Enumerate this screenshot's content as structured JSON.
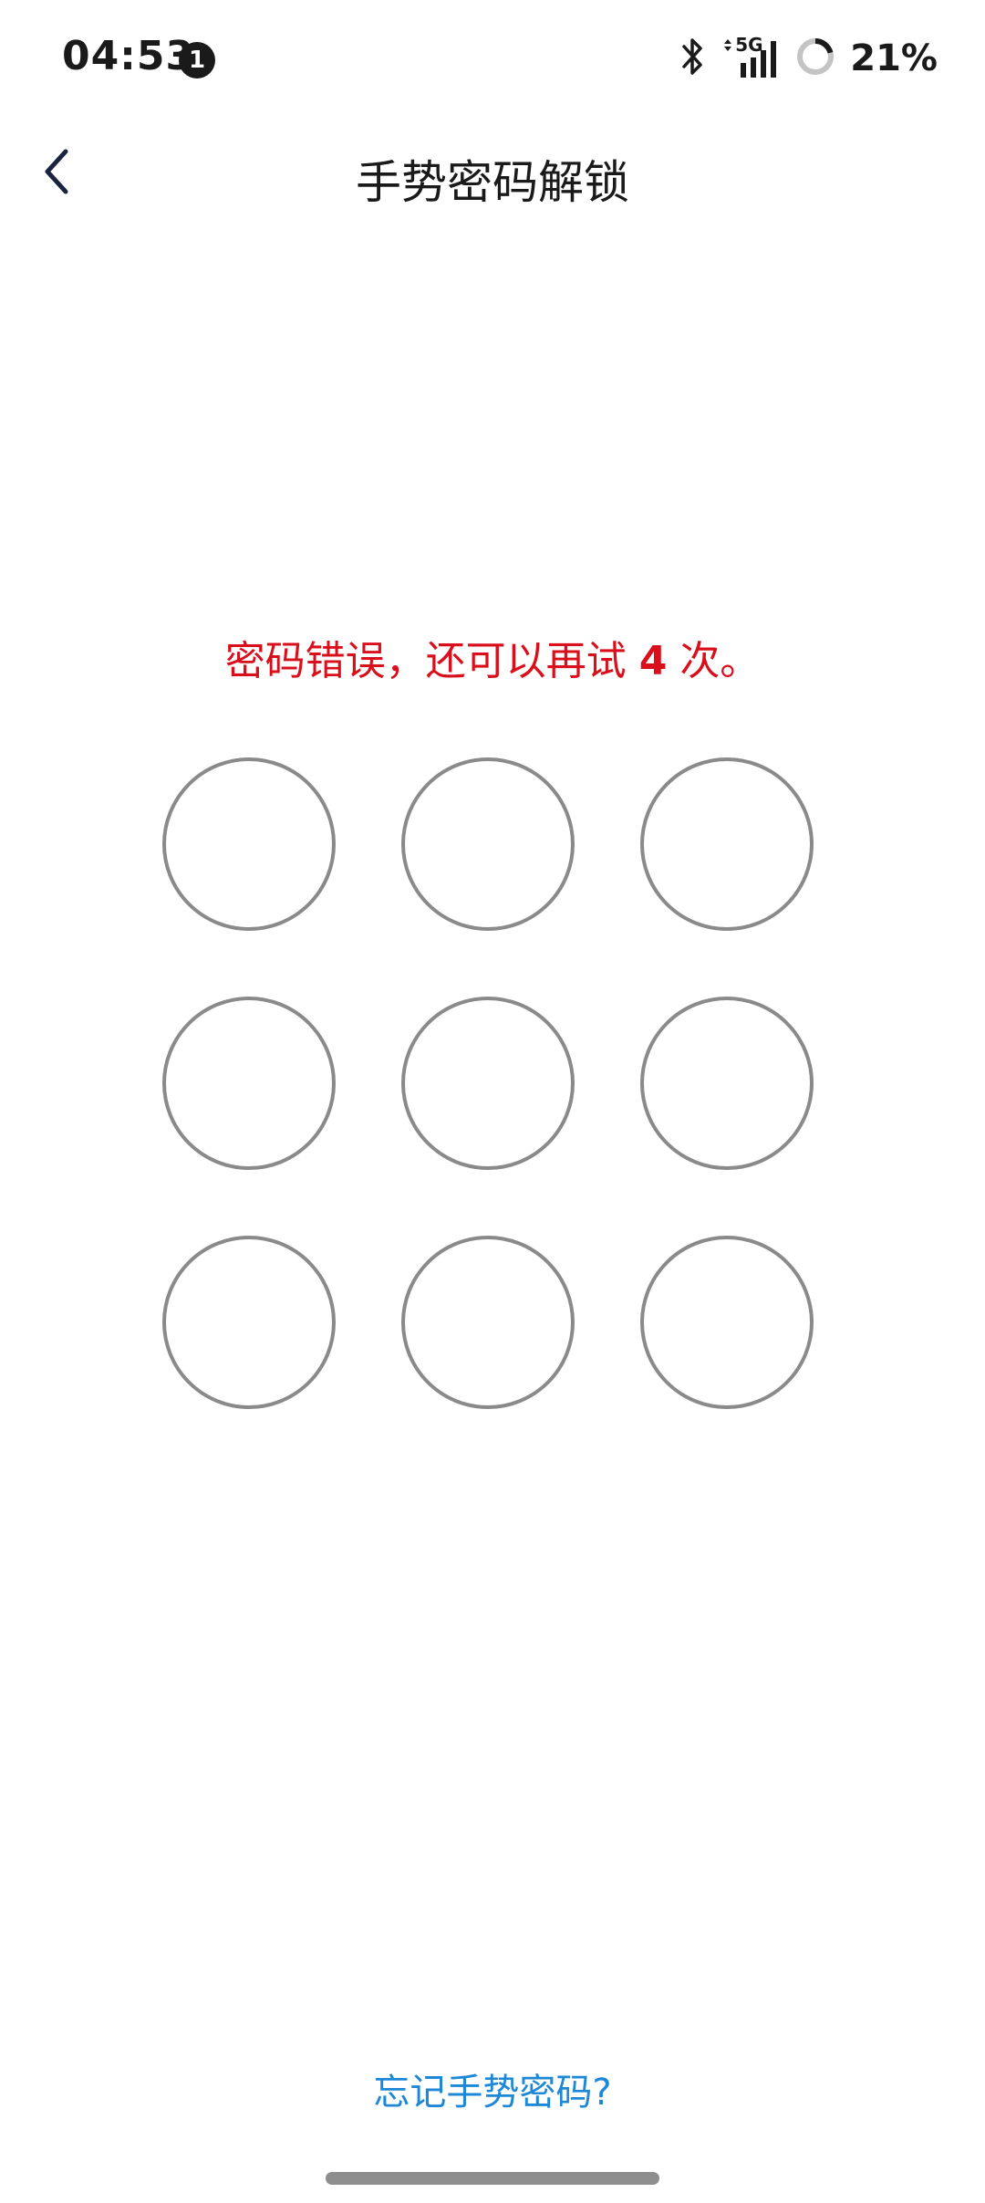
{
  "status_bar": {
    "time": "04:53",
    "notification_count": "1",
    "network": "5G",
    "battery_percent": "21%",
    "battery_level": 0.21
  },
  "header": {
    "title": "手势密码解锁"
  },
  "message": {
    "prefix": "密码错误，还可以再试",
    "attempts": "4",
    "suffix": "次。",
    "color": "#d9101c"
  },
  "pattern": {
    "rows": 3,
    "cols": 3
  },
  "footer": {
    "forgot_label": "忘记手势密码?",
    "link_color": "#1e88d6"
  },
  "icons": {
    "back": "chevron-left-icon",
    "bluetooth": "bluetooth-icon",
    "signal": "signal-icon",
    "battery": "battery-ring-icon"
  }
}
